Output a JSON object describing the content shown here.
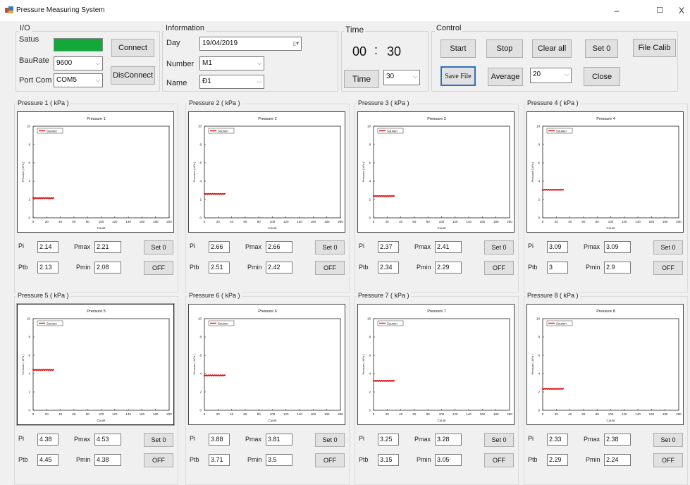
{
  "window": {
    "title": "Pressure Measuring System",
    "minimize": "–",
    "maximize": "☐",
    "close": "X"
  },
  "io": {
    "group_label": "I/O",
    "status_label": "Satus",
    "status_color": "#12a83a",
    "connect": "Connect",
    "baud_label": "BauRate",
    "baud_value": "9600",
    "port_label": "Port Com",
    "port_value": "COM5",
    "disconnect": "DisConnect"
  },
  "information": {
    "group_label": "Information",
    "day_label": "Day",
    "day_value": "19/04/2019",
    "number_label": "Number",
    "number_value": "M1",
    "name_label": "Name",
    "name_value": "Đ1"
  },
  "time": {
    "group_label": "Time",
    "minutes": "00",
    "separator": ":",
    "seconds": "30",
    "time_button": "Time",
    "interval_value": "30"
  },
  "control": {
    "group_label": "Control",
    "start": "Start",
    "stop": "Stop",
    "clear_all": "Clear all",
    "set0": "Set 0",
    "file_calib": "File Calib",
    "save_file": "Save File",
    "average": "Average",
    "average_value": "20",
    "close": "Close"
  },
  "panel_labels": {
    "pi": "Pi",
    "ptb": "Ptb",
    "pmax": "Pmax",
    "pmin": "Pmin",
    "set0": "Set 0",
    "off": "OFF"
  },
  "series_color": "#e01010",
  "panels": [
    {
      "title": "Pressure 1 ( kPa )",
      "chart_title": "Pressure 1",
      "legend": "Sounen",
      "pi": "2.14",
      "ptb": "2.13",
      "pmax": "2.21",
      "pmin": "2.08"
    },
    {
      "title": "Pressure 2 ( kPa )",
      "chart_title": "Pressure 2",
      "legend": "Sounen",
      "pi": "2.66",
      "ptb": "2.51",
      "pmax": "2.66",
      "pmin": "2.42"
    },
    {
      "title": "Pressure 3 ( kPa )",
      "chart_title": "Pressure 3",
      "legend": "Sounen",
      "pi": "2.37",
      "ptb": "2.34",
      "pmax": "2.41",
      "pmin": "2.29"
    },
    {
      "title": "Pressure 4 ( kPa )",
      "chart_title": "Pressure 4",
      "legend": "Sounen",
      "pi": "3.09",
      "ptb": "3",
      "pmax": "3.09",
      "pmin": "2.9"
    },
    {
      "title": "Pressure 5 ( kPa )",
      "chart_title": "Pressure 5",
      "legend": "Sounen",
      "pi": "4.38",
      "ptb": "4.45",
      "pmax": "4.53",
      "pmin": "4.38"
    },
    {
      "title": "Pressure 6 ( kPa )",
      "chart_title": "Pressure 6",
      "legend": "Sounen",
      "pi": "3.88",
      "ptb": "3.71",
      "pmax": "3.81",
      "pmin": "3.5"
    },
    {
      "title": "Pressure 7 ( kPa )",
      "chart_title": "Pressure 7",
      "legend": "Sounen",
      "pi": "3.25",
      "ptb": "3.15",
      "pmax": "3.28",
      "pmin": "3.05"
    },
    {
      "title": "Pressure 8 ( kPa )",
      "chart_title": "Pressure 8",
      "legend": "Sounen",
      "pi": "2.33",
      "ptb": "2.29",
      "pmax": "2.38",
      "pmin": "2.24"
    }
  ],
  "chart_data": [
    {
      "type": "scatter",
      "title": "Pressure 1",
      "xlabel": "Count",
      "ylabel": "Pressure ( kPa )",
      "xlim": [
        0,
        200
      ],
      "ylim": [
        0,
        10
      ],
      "x_ticks": [
        0,
        20,
        40,
        60,
        80,
        100,
        120,
        140,
        160,
        180,
        200
      ],
      "y_ticks": [
        0,
        2,
        4,
        6,
        8,
        10
      ],
      "series": [
        {
          "name": "Sounen",
          "x_range": [
            0,
            30
          ],
          "y": 2.14
        }
      ]
    },
    {
      "type": "scatter",
      "title": "Pressure 2",
      "xlabel": "Count",
      "ylabel": "Pressure ( kPa )",
      "xlim": [
        0,
        200
      ],
      "ylim": [
        0,
        10
      ],
      "x_ticks": [
        0,
        20,
        40,
        60,
        80,
        100,
        120,
        140,
        160,
        180,
        200
      ],
      "y_ticks": [
        0,
        2,
        4,
        6,
        8,
        10
      ],
      "series": [
        {
          "name": "Sounen",
          "x_range": [
            0,
            30
          ],
          "y": 2.6
        }
      ]
    },
    {
      "type": "scatter",
      "title": "Pressure 3",
      "xlabel": "Count",
      "ylabel": "Pressure ( kPa )",
      "xlim": [
        0,
        200
      ],
      "ylim": [
        0,
        10
      ],
      "x_ticks": [
        0,
        20,
        40,
        60,
        80,
        100,
        120,
        140,
        160,
        180,
        200
      ],
      "y_ticks": [
        0,
        2,
        4,
        6,
        8,
        10
      ],
      "series": [
        {
          "name": "Sounen",
          "x_range": [
            0,
            30
          ],
          "y": 2.37
        }
      ]
    },
    {
      "type": "scatter",
      "title": "Pressure 4",
      "xlabel": "Count",
      "ylabel": "Pressure ( kPa )",
      "xlim": [
        0,
        200
      ],
      "ylim": [
        0,
        10
      ],
      "x_ticks": [
        0,
        20,
        40,
        60,
        80,
        100,
        120,
        140,
        160,
        180,
        200
      ],
      "y_ticks": [
        0,
        2,
        4,
        6,
        8,
        10
      ],
      "series": [
        {
          "name": "Sounen",
          "x_range": [
            0,
            30
          ],
          "y": 3.05
        }
      ]
    },
    {
      "type": "scatter",
      "title": "Pressure 5",
      "xlabel": "Count",
      "ylabel": "Pressure ( kPa )",
      "xlim": [
        0,
        200
      ],
      "ylim": [
        0,
        10
      ],
      "x_ticks": [
        0,
        20,
        40,
        60,
        80,
        100,
        120,
        140,
        160,
        180,
        200
      ],
      "y_ticks": [
        0,
        2,
        4,
        6,
        8,
        10
      ],
      "series": [
        {
          "name": "Sounen",
          "x_range": [
            0,
            30
          ],
          "y": 4.4
        }
      ]
    },
    {
      "type": "scatter",
      "title": "Pressure 6",
      "xlabel": "Count",
      "ylabel": "Pressure ( kPa )",
      "xlim": [
        0,
        200
      ],
      "ylim": [
        0,
        10
      ],
      "x_ticks": [
        0,
        20,
        40,
        60,
        80,
        100,
        120,
        140,
        160,
        180,
        200
      ],
      "y_ticks": [
        0,
        2,
        4,
        6,
        8,
        10
      ],
      "series": [
        {
          "name": "Sounen",
          "x_range": [
            0,
            30
          ],
          "y": 3.8
        }
      ]
    },
    {
      "type": "scatter",
      "title": "Pressure 7",
      "xlabel": "Count",
      "ylabel": "Pressure ( kPa )",
      "xlim": [
        0,
        200
      ],
      "ylim": [
        0,
        10
      ],
      "x_ticks": [
        0,
        20,
        40,
        60,
        80,
        100,
        120,
        140,
        160,
        180,
        200
      ],
      "y_ticks": [
        0,
        2,
        4,
        6,
        8,
        10
      ],
      "series": [
        {
          "name": "Sounen",
          "x_range": [
            0,
            30
          ],
          "y": 3.2
        }
      ]
    },
    {
      "type": "scatter",
      "title": "Pressure 8",
      "xlabel": "Count",
      "ylabel": "Pressure ( kPa )",
      "xlim": [
        0,
        200
      ],
      "ylim": [
        0,
        10
      ],
      "x_ticks": [
        0,
        20,
        40,
        60,
        80,
        100,
        120,
        140,
        160,
        180,
        200
      ],
      "y_ticks": [
        0,
        2,
        4,
        6,
        8,
        10
      ],
      "series": [
        {
          "name": "Sounen",
          "x_range": [
            0,
            30
          ],
          "y": 2.33
        }
      ]
    }
  ]
}
